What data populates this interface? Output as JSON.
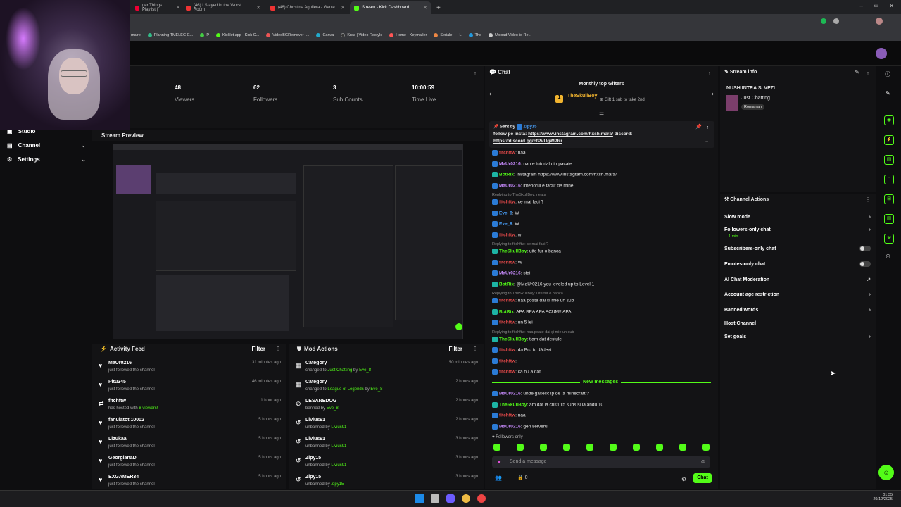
{
  "browser": {
    "tabs": [
      {
        "label": "ger Things Playlist |"
      },
      {
        "label": "(46) I Stayed in the Worst Room"
      },
      {
        "label": "(46) Christina Aguilera - Genie"
      },
      {
        "label": "Stream - Kick Dashboard"
      }
    ],
    "bookmarks": [
      "maire",
      "Planning TMELEC G...",
      "P",
      "Kicklet.app - Kick C...",
      "VideoBGRemover -...",
      "Canva",
      "Krea | Video Restyle",
      "Home - Keymailer",
      "Seriale",
      "L",
      "The",
      "Upload Video to Re..."
    ]
  },
  "nav": {
    "items": [
      {
        "label": "Studio"
      },
      {
        "label": "Channel"
      },
      {
        "label": "Settings"
      }
    ]
  },
  "stats": [
    {
      "value": "48",
      "label": "Viewers"
    },
    {
      "value": "62",
      "label": "Followers"
    },
    {
      "value": "3",
      "label": "Sub Counts"
    },
    {
      "value": "10:00:59",
      "label": "Time Live"
    }
  ],
  "preview": {
    "title": "Stream Preview"
  },
  "activity": {
    "title": "Activity Feed",
    "filter": "Filter",
    "rows": [
      {
        "name": "MaUr0216",
        "sub": "just followed the channel",
        "time": "31 minutes ago"
      },
      {
        "name": "Pitu345",
        "sub": "just followed the channel",
        "time": "46 minutes ago"
      },
      {
        "name": "fitchftw",
        "sub_a": "has hosted with ",
        "sub_b": "8 viewers!",
        "time": "1 hour ago"
      },
      {
        "name": "fanulatoti10002",
        "sub": "just followed the channel",
        "time": "5 hours ago"
      },
      {
        "name": "Lizukaa",
        "sub": "just followed the channel",
        "time": "5 hours ago"
      },
      {
        "name": "GeorgianaD",
        "sub": "just followed the channel",
        "time": "5 hours ago"
      },
      {
        "name": "EXGAMER34",
        "sub": "just followed the channel",
        "time": "5 hours ago"
      }
    ]
  },
  "mod": {
    "title": "Mod Actions",
    "filter": "Filter",
    "rows": [
      {
        "name": "Category",
        "sub_a": "changed to ",
        "sub_b": "Just Chatting",
        "sub_c": " by ",
        "sub_d": "Eve_8",
        "time": "50 minutes ago"
      },
      {
        "name": "Category",
        "sub_a": "changed to ",
        "sub_b": "League of Legends",
        "sub_c": " by ",
        "sub_d": "Eve_8",
        "time": "2 hours ago"
      },
      {
        "name": "LESANEDOG",
        "sub_a": "banned by ",
        "sub_b": "Eve_8",
        "time": "2 hours ago"
      },
      {
        "name": "Livius91",
        "sub_a": "unbanned by ",
        "sub_b": "Livius91",
        "time": "2 hours ago"
      },
      {
        "name": "Livius91",
        "sub_a": "unbanned by ",
        "sub_b": "Livius91",
        "time": "3 hours ago"
      },
      {
        "name": "Zipy15",
        "sub_a": "unbanned by ",
        "sub_b": "Livius91",
        "time": "3 hours ago"
      },
      {
        "name": "Zipy15",
        "sub_a": "unbanned by ",
        "sub_b": "Zipy15",
        "time": "3 hours ago"
      }
    ]
  },
  "chat": {
    "title": "Chat",
    "gifters_title": "Monthly top Gifters",
    "gifter_name": "TheSkullBoy",
    "gifter_rank": "1",
    "gift_hint": "Gift 1 sub to take 2nd",
    "pinned_by": "Sent by",
    "pinned_user": "Zipy15",
    "pinned_text": "follow pe insta: ",
    "pinned_link1": "https://www.instagram.com/hxsh.mara/",
    "pinned_mid": " discord:",
    "pinned_link2": "https://discord.gg/FfPVUgWPRr",
    "messages": [
      {
        "user": "fitchftw",
        "text": "naa",
        "color": "#e84a4a"
      },
      {
        "user": "MaUr0216",
        "text": "nah e tutorial din pacate",
        "color": "#c98cff"
      },
      {
        "user": "BotRix",
        "text": "Instagram ",
        "link": "https://www.instagram.com/hxsh.mara/",
        "color": "#53fc18"
      },
      {
        "user": "MaUr0216",
        "text": "interiorul e facut de mine",
        "color": "#c98cff"
      },
      {
        "reply": "Replying to TheSkullBoy: neata",
        "user": "fitchftw",
        "text": "ce mai faci ?",
        "color": "#e84a4a"
      },
      {
        "user": "Eve_8",
        "text": "W",
        "color": "#4aa3ff"
      },
      {
        "user": "Eve_8",
        "text": "W",
        "color": "#4aa3ff"
      },
      {
        "user": "fitchftw",
        "text": "w",
        "color": "#e84a4a"
      },
      {
        "reply": "Replying to fitchftw: ce mai faci ?",
        "user": "TheSkullBoy",
        "text": "uite fur o banca",
        "color": "#53fc18"
      },
      {
        "user": "fitchftw",
        "text": "W",
        "color": "#e84a4a"
      },
      {
        "user": "MaUr0216",
        "text": "stai",
        "color": "#c98cff"
      },
      {
        "user": "BotRix",
        "text": "@MaUr0216 you leveled up to Level 1",
        "color": "#53fc18"
      },
      {
        "reply": "Replying to TheSkullBoy: uite fur o banca",
        "user": "fitchftw",
        "text": "naa poate dai și mie un sub",
        "color": "#e84a4a"
      },
      {
        "user": "BotRix",
        "text": "APA BEA APA ACUM!! APA",
        "color": "#53fc18"
      },
      {
        "user": "fitchftw",
        "text": "un 5 lei",
        "color": "#e84a4a"
      },
      {
        "reply": "Replying to fitchftw: naa poate dai și mie un sub",
        "user": "TheSkullBoy",
        "text": "tiam dat destule",
        "color": "#53fc18"
      },
      {
        "user": "fitchftw",
        "text": "da Bro tu dădeai",
        "color": "#e84a4a"
      },
      {
        "user": "fitchftw",
        "text": "",
        "color": "#e84a4a"
      },
      {
        "user": "fitchftw",
        "text": "ca nu a dat",
        "color": "#e84a4a"
      }
    ],
    "new_messages": "New messages",
    "new": [
      {
        "user": "MaUr0216",
        "text": "unde gasesc ip de la minecraft ?",
        "color": "#c98cff"
      },
      {
        "user": "TheSkullBoy",
        "text": "am dat la cristi 15 subs si la andu 10",
        "color": "#53fc18"
      },
      {
        "user": "fitchftw",
        "text": "naa",
        "color": "#e84a4a"
      },
      {
        "user": "MaUr0216",
        "text": "gen serverul",
        "color": "#c98cff"
      }
    ],
    "followers_only": "Followers only",
    "placeholder": "Send a message",
    "count": "0",
    "send": "Chat"
  },
  "info": {
    "title": "Stream info",
    "stream_title": "NUSH INTRA SI VEZI",
    "category": "Just Chatting",
    "tag": "Romanian"
  },
  "actions": {
    "title": "Channel Actions",
    "items": [
      {
        "label": "Slow mode"
      },
      {
        "label": "Followers-only chat",
        "sub": "1 min"
      },
      {
        "label": "Subscribers-only chat"
      },
      {
        "label": "Emotes-only chat"
      },
      {
        "label": "AI Chat Moderation"
      },
      {
        "label": "Account age restriction"
      },
      {
        "label": "Banned words"
      },
      {
        "label": "Host Channel"
      },
      {
        "label": "Set goals"
      }
    ]
  },
  "clock": {
    "time": "01:35",
    "date": "29/12/2025"
  },
  "colors": {
    "accent": "#53fc18",
    "bg": "#0e0e10",
    "panel": "#131315"
  }
}
